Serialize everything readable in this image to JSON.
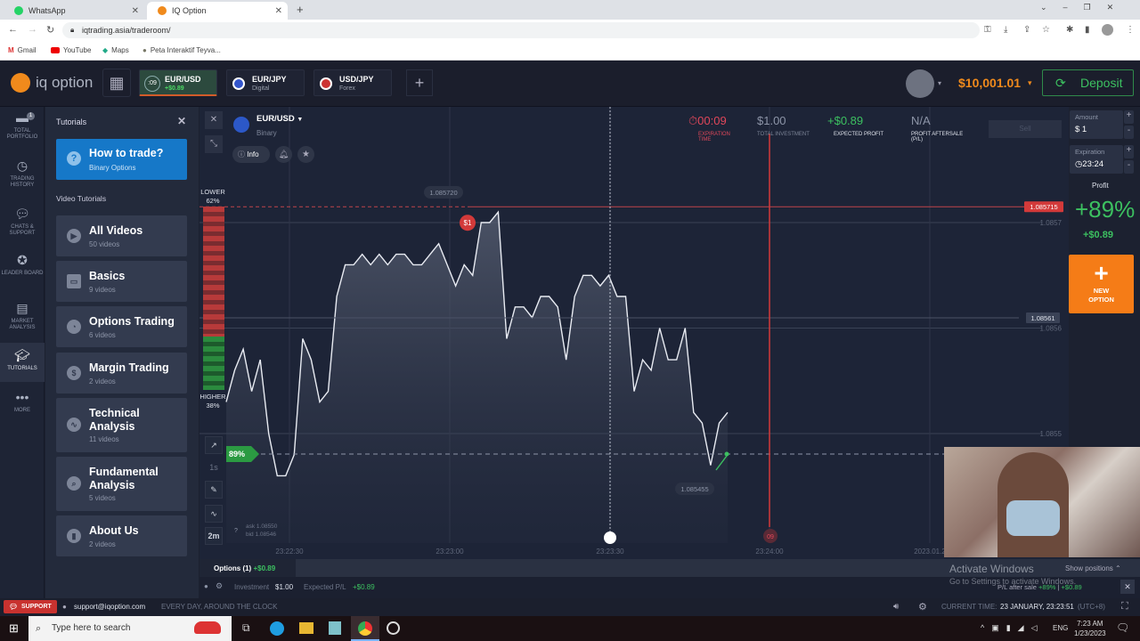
{
  "browser": {
    "tabs": [
      {
        "label": "WhatsApp",
        "icon": "whatsapp-icon",
        "active": false
      },
      {
        "label": "IQ Option",
        "icon": "iqoption-icon",
        "active": true
      }
    ],
    "url": "iqtrading.asia/traderoom/",
    "bookmarks": [
      {
        "label": "Gmail",
        "icon": "gmail-icon"
      },
      {
        "label": "YouTube",
        "icon": "youtube-icon"
      },
      {
        "label": "Maps",
        "icon": "maps-icon"
      },
      {
        "label": "Peta Interaktif Teyva...",
        "icon": "globe-icon"
      }
    ]
  },
  "header": {
    "logo": "iq option",
    "asset_tabs": [
      {
        "name": "EUR/USD",
        "sub": "+$0.89",
        "timer": ":09",
        "active": true
      },
      {
        "name": "EUR/JPY",
        "sub": "Digital",
        "active": false
      },
      {
        "name": "USD/JPY",
        "sub": "Forex",
        "active": false
      }
    ],
    "balance": "$10,001.01",
    "deposit_label": "Deposit"
  },
  "leftnav": [
    {
      "label": "TOTAL PORTFOLIO",
      "icon": "portfolio-icon",
      "badge": "1"
    },
    {
      "label": "TRADING HISTORY",
      "icon": "history-icon"
    },
    {
      "label": "CHATS & SUPPORT",
      "icon": "chat-icon"
    },
    {
      "label": "LEADER BOARD",
      "icon": "leaderboard-icon"
    },
    {
      "label": "MARKET ANALYSIS",
      "icon": "news-icon"
    },
    {
      "label": "TUTORIALS",
      "icon": "graduation-cap-icon",
      "active": true
    },
    {
      "label": "MORE",
      "icon": "more-icon"
    }
  ],
  "tutorials": {
    "title": "Tutorials",
    "how_to": {
      "title": "How to trade?",
      "sub": "Binary Options"
    },
    "section": "Video Tutorials",
    "cards": [
      {
        "title": "All Videos",
        "sub": "50 videos",
        "icon": "play-icon"
      },
      {
        "title": "Basics",
        "sub": "9 videos",
        "icon": "folder-icon"
      },
      {
        "title": "Options Trading",
        "sub": "6 videos",
        "icon": "pie-icon"
      },
      {
        "title": "Margin Trading",
        "sub": "2 videos",
        "icon": "dollar-icon"
      },
      {
        "title": "Technical Analysis",
        "sub": "11 videos",
        "icon": "trend-icon"
      },
      {
        "title": "Fundamental Analysis",
        "sub": "5 videos",
        "icon": "magnifier-icon"
      },
      {
        "title": "About Us",
        "sub": "2 videos",
        "icon": "bar-chart-icon"
      }
    ]
  },
  "asset": {
    "name": "EUR/USD",
    "type": "Binary",
    "info_label": "Info"
  },
  "trade_info": {
    "expiration": "00:09",
    "expiration_label": "EXPIRATION TIME",
    "investment": "$1.00",
    "investment_label": "TOTAL INVESTMENT",
    "expected_profit": "+$0.89",
    "expected_profit_label": "EXPECTED PROFIT",
    "after_sale": "N/A",
    "after_sale_label": "PROFIT AFTERSALE (P/L)",
    "sell_label": "Sell"
  },
  "sentiment": {
    "lower_label": "LOWER",
    "lower": "62%",
    "higher_label": "HIGHER",
    "higher": "38%"
  },
  "chart_data": {
    "type": "area",
    "series_name": "EUR/USD",
    "x_ticks": [
      "23:22:30",
      "23:23:00",
      "23:23:30",
      "23:24:00",
      "2023.01.2"
    ],
    "y_ticks": [
      "1.0857",
      "1.0856",
      "1.0855"
    ],
    "prices": [
      1.08553,
      1.08556,
      1.08558,
      1.08554,
      1.08557,
      1.0855,
      1.08546,
      1.08546,
      1.08548,
      1.08559,
      1.08557,
      1.08553,
      1.08554,
      1.08563,
      1.08566,
      1.08566,
      1.08567,
      1.08566,
      1.08567,
      1.08566,
      1.08567,
      1.08567,
      1.08566,
      1.08566,
      1.08567,
      1.08568,
      1.08566,
      1.08564,
      1.08566,
      1.08565,
      1.0857,
      1.0857,
      1.08571,
      1.08559,
      1.08562,
      1.08562,
      1.08561,
      1.08563,
      1.08563,
      1.08562,
      1.08557,
      1.08563,
      1.08565,
      1.08565,
      1.08564,
      1.08565,
      1.08563,
      1.08563,
      1.08554,
      1.08557,
      1.08556,
      1.0856,
      1.08557,
      1.08557,
      1.0856,
      1.08552,
      1.08551,
      1.08547,
      1.08551,
      1.08552
    ],
    "markers": {
      "high": "1.085720",
      "low": "1.085455",
      "entry": "1.085715",
      "current": "1.08561"
    },
    "trade_label": "$1",
    "payout_tag": "89%",
    "expiry_tag": "09",
    "ask": "ask 1.08550",
    "bid": "bid 1.08546"
  },
  "chart_tools": [
    "chart-type-icon",
    "1s",
    "pencil-icon",
    "indicator-icon",
    "2m"
  ],
  "right_panel": {
    "amount_label": "Amount",
    "amount": "$ 1",
    "expiration_label": "Expiration",
    "expiration": "23:24",
    "profit_label": "Profit",
    "profit_pct": "+89%",
    "profit_amount": "+$0.89",
    "new_option": "NEW OPTION"
  },
  "options_bar": {
    "tab": "Options (1)",
    "tab_profit": "+$0.89",
    "investment_label": "Investment",
    "investment": "$1.00",
    "expected_label": "Expected P/L",
    "expected": "+$0.89",
    "show_positions": "Show positions",
    "after_sale": "P/L after sale",
    "after_sale_pct": "+89%",
    "after_sale_amt": "+$0.89"
  },
  "watermark": {
    "title": "Activate Windows",
    "sub": "Go to Settings to activate Windows."
  },
  "support": {
    "button": "SUPPORT",
    "email": "support@iqoption.com",
    "hours": "EVERY DAY, AROUND THE CLOCK",
    "current_time_label": "CURRENT TIME:",
    "current_time": "23 JANUARY, 23:23:51",
    "tz": "(UTC+8)"
  },
  "taskbar": {
    "search_placeholder": "Type here to search",
    "lang": "ENG",
    "time": "7:23 AM",
    "date": "1/23/2023"
  }
}
